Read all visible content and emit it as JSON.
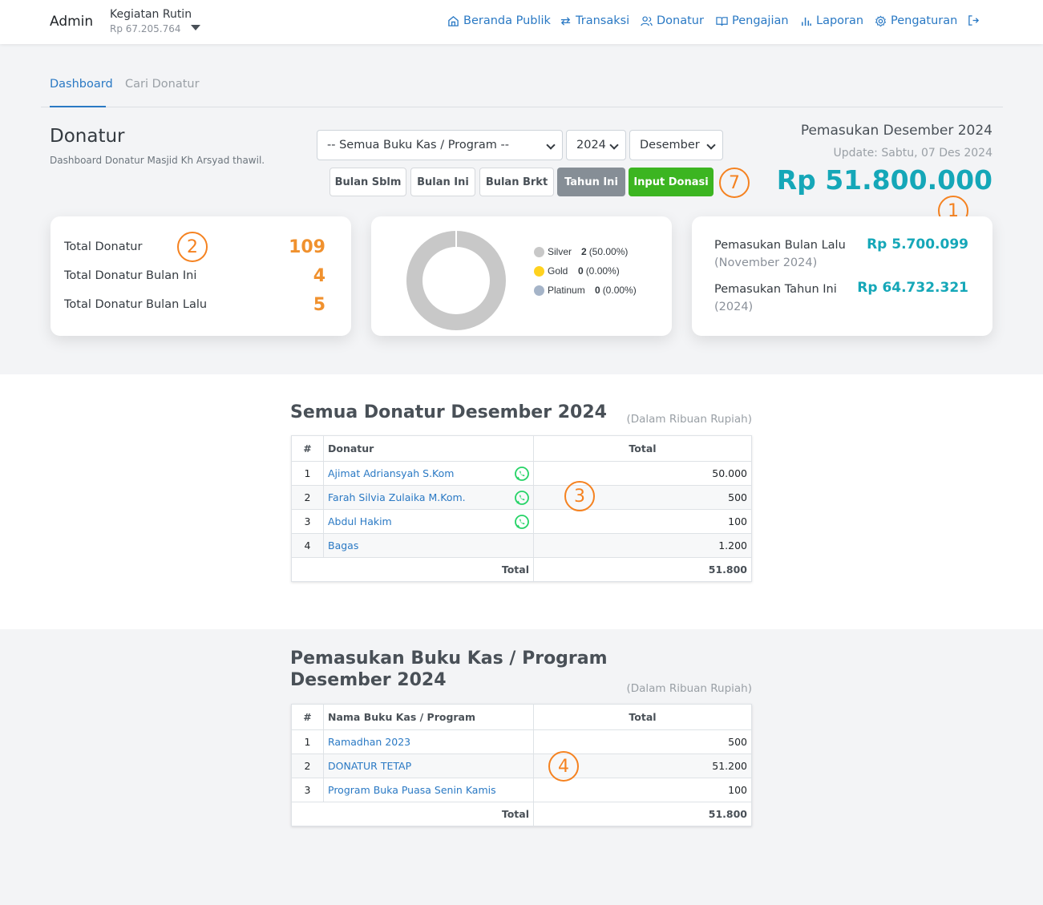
{
  "navbar": {
    "brand": "Admin",
    "org_name": "Kegiatan Rutin",
    "org_balance": "Rp 67.205.764",
    "links": {
      "beranda": "Beranda Publik",
      "transaksi": "Transaksi",
      "donatur": "Donatur",
      "pengajian": "Pengajian",
      "laporan": "Laporan",
      "pengaturan": "Pengaturan"
    }
  },
  "tabs": {
    "dashboard": "Dashboard",
    "cari": "Cari Donatur"
  },
  "header": {
    "title": "Donatur",
    "subtitle": "Dashboard Donatur Masjid Kh Arsyad thawil."
  },
  "filters": {
    "program": "-- Semua Buku Kas / Program --",
    "year": "2024",
    "month": "Desember"
  },
  "buttons": {
    "prev": "Bulan Sblm",
    "current": "Bulan Ini",
    "next": "Bulan Brkt",
    "year": "Tahun Ini",
    "input": "Input Donasi"
  },
  "income": {
    "title": "Pemasukan Desember 2024",
    "update": "Update: Sabtu, 07 Des 2024",
    "amount": "Rp 51.800.000"
  },
  "callouts": {
    "c1": "1",
    "c2": "2",
    "c3": "3",
    "c4": "4",
    "c7": "7"
  },
  "stats": {
    "total_label": "Total Donatur",
    "total_value": "109",
    "month_label": "Total Donatur Bulan Ini",
    "month_value": "4",
    "last_label": "Total Donatur Bulan Lalu",
    "last_value": "5"
  },
  "tiers": {
    "silver": {
      "name": "Silver",
      "count": "2",
      "pct": "(50.00%)",
      "color": "#c8c8c8"
    },
    "gold": {
      "name": "Gold",
      "count": "0",
      "pct": "(0.00%)",
      "color": "#ffd21f"
    },
    "platinum": {
      "name": "Platinum",
      "count": "0",
      "pct": "(0.00%)",
      "color": "#a5b4c8"
    }
  },
  "income_card": {
    "last_month_label": "Pemasukan Bulan Lalu",
    "last_month_period": "(November 2024)",
    "last_month_value": "Rp 5.700.099",
    "year_label": "Pemasukan Tahun Ini",
    "year_period": "(2024)",
    "year_value": "Rp 64.732.321"
  },
  "donors_section": {
    "title": "Semua Donatur Desember 2024",
    "note": "(Dalam Ribuan Rupiah)",
    "col_num": "#",
    "col_name": "Donatur",
    "col_total": "Total",
    "rows": [
      {
        "num": "1",
        "name": "Ajimat Adriansyah S.Kom",
        "total": "50.000"
      },
      {
        "num": "2",
        "name": "Farah Silvia Zulaika M.Kom.",
        "total": "500"
      },
      {
        "num": "3",
        "name": "Abdul Hakim",
        "total": "100"
      },
      {
        "num": "4",
        "name": "Bagas",
        "total": "1.200"
      }
    ],
    "total_label": "Total",
    "total_value": "51.800"
  },
  "program_section": {
    "title_line1": "Pemasukan Buku Kas / Program",
    "title_line2": "Desember 2024",
    "note": "(Dalam Ribuan Rupiah)",
    "col_num": "#",
    "col_name": "Nama Buku Kas / Program",
    "col_total": "Total",
    "rows": [
      {
        "num": "1",
        "name": "Ramadhan 2023",
        "total": "500"
      },
      {
        "num": "2",
        "name": "DONATUR TETAP",
        "total": "51.200"
      },
      {
        "num": "3",
        "name": "Program Buka Puasa Senin Kamis",
        "total": "100"
      }
    ],
    "total_label": "Total",
    "total_value": "51.800"
  }
}
